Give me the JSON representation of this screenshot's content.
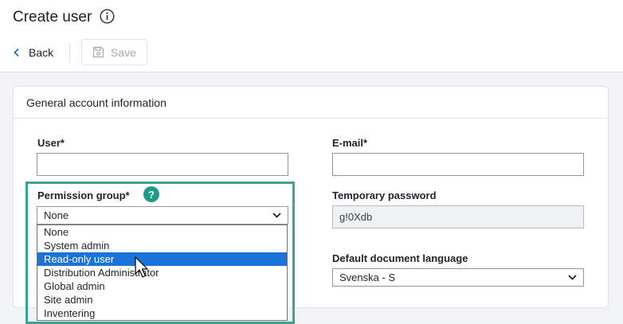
{
  "page": {
    "title": "Create user"
  },
  "toolbar": {
    "back_label": "Back",
    "save_label": "Save"
  },
  "card": {
    "title": "General account information"
  },
  "form": {
    "user_label": "User*",
    "user_value": "",
    "email_label": "E-mail*",
    "email_value": "",
    "permission_label": "Permission group*",
    "permission_value": "None",
    "permission_options": [
      "None",
      "System admin",
      "Read-only user",
      "Distribution Administrator",
      "Global admin",
      "Site admin",
      "Inventering"
    ],
    "permission_highlighted": "Read-only user",
    "temp_password_label": "Temporary password",
    "temp_password_value": "g!0Xdb",
    "language_label": "Default document language",
    "language_value": "Svenska - S",
    "help_glyph": "?"
  },
  "colors": {
    "accent": "#1f9b8b",
    "highlight_border": "#3aa58c",
    "selected_option": "#1a73d9"
  }
}
